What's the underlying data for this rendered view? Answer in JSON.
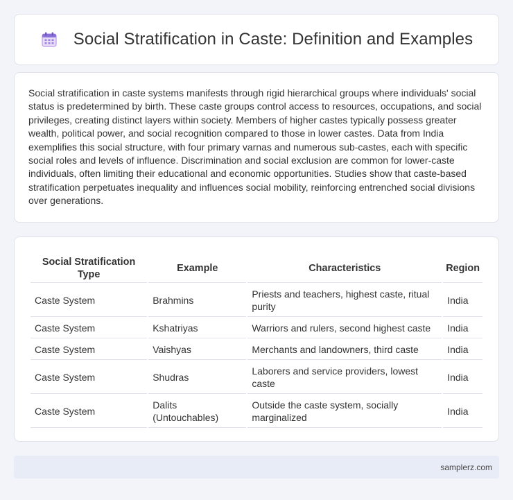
{
  "header": {
    "title": "Social Stratification in Caste: Definition and Examples",
    "icon": "calendar-icon"
  },
  "intro": {
    "text": "Social stratification in caste systems manifests through rigid hierarchical groups where individuals' social status is predetermined by birth. These caste groups control access to resources, occupations, and social privileges, creating distinct layers within society. Members of higher castes typically possess greater wealth, political power, and social recognition compared to those in lower castes. Data from India exemplifies this social structure, with four primary varnas and numerous sub-castes, each with specific social roles and levels of influence. Discrimination and social exclusion are common for lower-caste individuals, often limiting their educational and economic opportunities. Studies show that caste-based stratification perpetuates inequality and influences social mobility, reinforcing entrenched social divisions over generations."
  },
  "table": {
    "headers": [
      "Social Stratification Type",
      "Example",
      "Characteristics",
      "Region"
    ],
    "rows": [
      [
        "Caste System",
        "Brahmins",
        "Priests and teachers, highest caste, ritual purity",
        "India"
      ],
      [
        "Caste System",
        "Kshatriyas",
        "Warriors and rulers, second highest caste",
        "India"
      ],
      [
        "Caste System",
        "Vaishyas",
        "Merchants and landowners, third caste",
        "India"
      ],
      [
        "Caste System",
        "Shudras",
        "Laborers and service providers, lowest caste",
        "India"
      ],
      [
        "Caste System",
        "Dalits (Untouchables)",
        "Outside the caste system, socially marginalized",
        "India"
      ]
    ]
  },
  "footer": {
    "text": "samplerz.com"
  }
}
